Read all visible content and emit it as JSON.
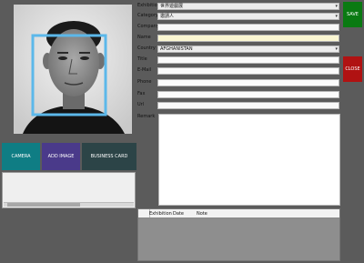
{
  "form": {
    "labels": {
      "exhibition": "Exhibition",
      "category": "Category",
      "company": "Company",
      "name": "Name",
      "country": "Country",
      "title": "Title",
      "email": "E-Mail",
      "phone": "Phone",
      "fax": "Fax",
      "url": "Url",
      "remark": "Remark"
    },
    "values": {
      "exhibition": "世界遊戲展",
      "category": "邀請人",
      "company": "",
      "name": "",
      "country": "AFGHANISTAN",
      "title": "",
      "email": "",
      "phone": "",
      "fax": "",
      "url": "",
      "remark": ""
    }
  },
  "buttons": {
    "camera": "CAMERA",
    "add_image": "ADD IMAGE",
    "business_card": "BUSINESS CARD",
    "save": "SAVE",
    "close": "CLOSE"
  },
  "history": {
    "columns": [
      "Exhibition",
      "Date",
      "Note"
    ]
  },
  "colors": {
    "camera": "#0f7d84",
    "add_image": "#4a3a8a",
    "business_card": "#2c4447",
    "save": "#0a7a12",
    "close": "#b01212",
    "face_frame": "#5cb8ea"
  }
}
